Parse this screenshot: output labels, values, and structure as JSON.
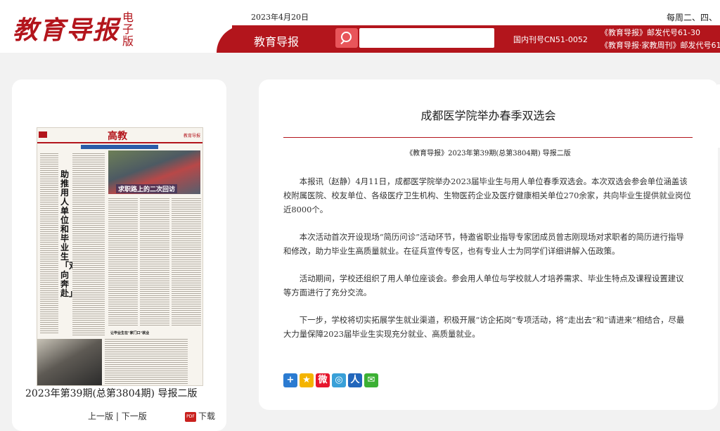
{
  "header": {
    "logo_text": "教育导报",
    "logo_sub": "电子版",
    "date": "2023年4月20日",
    "pub_days": "每周二、四、",
    "bar_title": "教育导报",
    "search_placeholder": "",
    "issn": "国内刊号CN51-0052",
    "postal_line1": "《教育导报》邮发代号61-30",
    "postal_line2": "《教育导报·家教周刊》邮发代号61"
  },
  "left_panel": {
    "thumb_masthead": "高教",
    "thumb_right": "教育导报",
    "thumb_headline": "助推用人单位和毕业生「双向奔赴」",
    "thumb_photo_label": "求职路上的二次回访",
    "thumb_sub": "让毕业生在\"家门口\"就业",
    "page_caption": "2023年第39期(总第3804期) 导报二版",
    "prev_label": "上一版",
    "separator": " | ",
    "next_label": "下一版",
    "download_label": "下载",
    "pdf_label": "PDF"
  },
  "article": {
    "title": "成都医学院举办春季双选会",
    "source": "《教育导报》2023年第39期(总第3804期) 导报二版",
    "paragraphs": [
      "本报讯（赵静）4月11日，成都医学院举办2023届毕业生与用人单位春季双选会。本次双选会参会单位涵盖该校附属医院、校友单位、各级医疗卫生机构、生物医药企业及医疗健康相关单位270余家，共向毕业生提供就业岗位近8000个。",
      "本次活动首次开设现场“简历问诊”活动环节，特邀省职业指导专家团成员曾志刚现场对求职者的简历进行指导和修改，助力毕业生高质量就业。在征兵宣传专区，也有专业人士为同学们详细讲解入伍政策。",
      "活动期间，学校还组织了用人单位座谈会。参会用人单位与学校就人才培养需求、毕业生特点及课程设置建议等方面进行了充分交流。",
      "下一步，学校将切实拓展学生就业渠道，积极开展“访企拓岗”专项活动，将“走出去”和“请进来”相结合，尽最大力量保障2023届毕业生实现充分就业、高质量就业。"
    ],
    "share_icons": [
      {
        "name": "share-more-icon",
        "glyph": "+",
        "color": "#2b7bd1"
      },
      {
        "name": "qzone-icon",
        "glyph": "★",
        "color": "#f4b400"
      },
      {
        "name": "weibo-icon",
        "glyph": "微",
        "color": "#e6162d"
      },
      {
        "name": "tencent-weibo-icon",
        "glyph": "◎",
        "color": "#39a0d8"
      },
      {
        "name": "renren-icon",
        "glyph": "人",
        "color": "#2266bb"
      },
      {
        "name": "wechat-icon",
        "glyph": "✉",
        "color": "#3cb034"
      }
    ]
  },
  "colors": {
    "brand_red": "#b3151c",
    "search_btn": "#e8555a",
    "page_bg": "#f2f2f2"
  }
}
